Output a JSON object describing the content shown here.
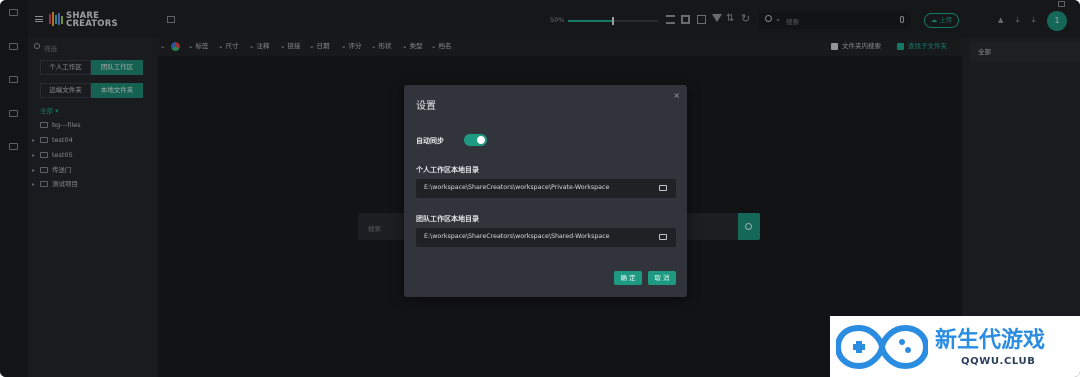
{
  "brand": {
    "line1": "SHARE",
    "line2": "CREATORS"
  },
  "topbar": {
    "zoom": "50%",
    "zoom_level": 0.5,
    "search_placeholder": "搜索",
    "upload_label": "上传",
    "avatar_letter": "1"
  },
  "left_panel": {
    "search_placeholder": "筛选",
    "workspace_tabs": [
      "个人工作区",
      "团队工作区"
    ],
    "active_workspace": "团队工作区",
    "folder_tabs": [
      "远端文件夹",
      "本地文件夹"
    ],
    "active_folder_tab": "本地文件夹",
    "tree_root": "全部",
    "tree_items": [
      "bg---files",
      "test04",
      "test05",
      "传送门",
      "测试项目"
    ]
  },
  "filterbar": {
    "items": [
      "标签",
      "尺寸",
      "注释",
      "链接",
      "日期",
      "评分",
      "形状",
      "类型",
      "档名"
    ],
    "search_in_folder": "文件夹内搜索",
    "include_subfolders": "查找子文件夹"
  },
  "main": {
    "search_placeholder": "搜索"
  },
  "right_panel": {
    "header": "全部"
  },
  "modal": {
    "title": "设置",
    "close": "×",
    "auto_sync_label": "自动同步",
    "auto_sync_on": true,
    "personal_label": "个人工作区本地目录",
    "personal_path": "E:\\workspace\\ShareCreators\\workspace\\Private-Workspace",
    "team_label": "团队工作区本地目录",
    "team_path": "E:\\workspace\\ShareCreators\\workspace\\Shared-Workspace",
    "confirm": "确 定",
    "cancel": "取 消"
  },
  "watermark": {
    "title": "新生代游戏",
    "sub": "QQWU.CLUB"
  },
  "colors": {
    "accent": "#1f9a82",
    "bg": "#202226",
    "modal_bg": "#31343a"
  },
  "icons": [
    "folder-icon",
    "menu-icon",
    "grid-icon",
    "filter-icon",
    "sort-icon",
    "refresh-icon",
    "search-icon",
    "mic-icon",
    "upload-icon",
    "bell-icon",
    "download-icon",
    "close-icon"
  ]
}
